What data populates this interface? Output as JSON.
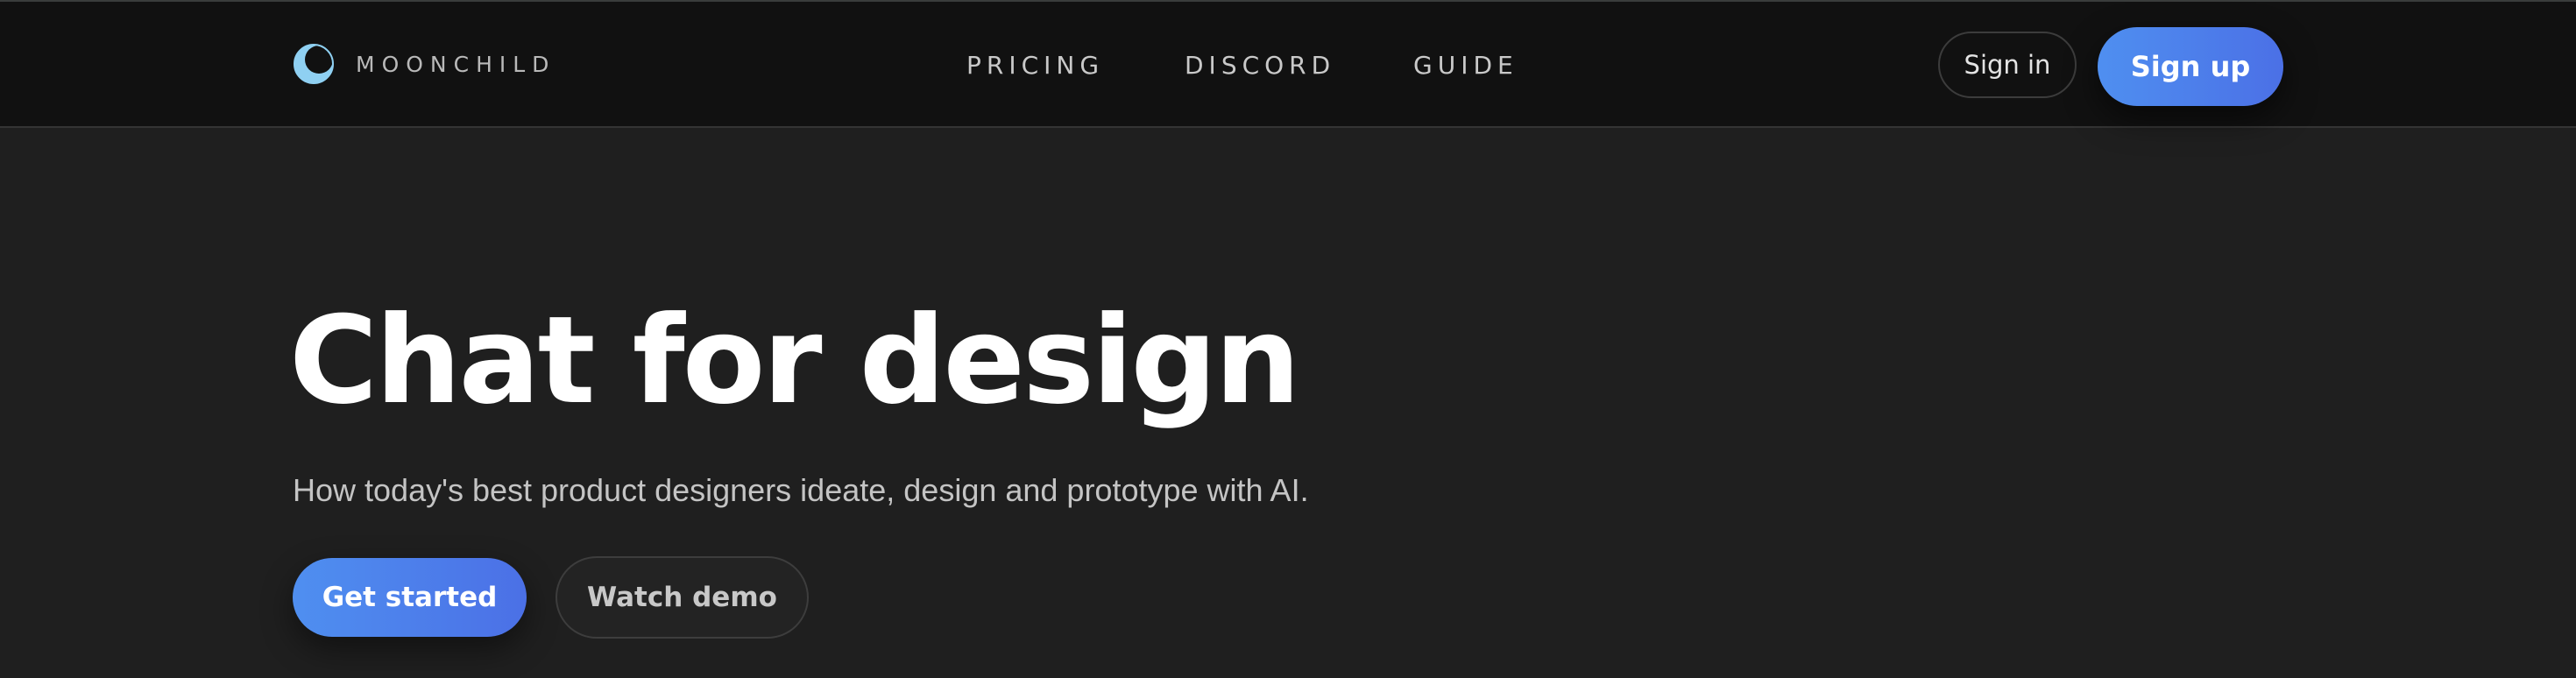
{
  "header": {
    "brand": "MOONCHILD",
    "logo_icon": "crescent-moon-icon",
    "nav": [
      {
        "label": "PRICING"
      },
      {
        "label": "DISCORD"
      },
      {
        "label": "GUIDE"
      }
    ],
    "sign_in_label": "Sign in",
    "sign_up_label": "Sign up"
  },
  "hero": {
    "title": "Chat for design",
    "subtitle": "How today's best product designers ideate, design and prototype with AI.",
    "primary_cta": "Get started",
    "secondary_cta": "Watch demo"
  },
  "colors": {
    "header_bg": "#111111",
    "page_bg": "#1f1f1f",
    "accent_start": "#4f8ff0",
    "accent_end": "#4b70e6",
    "logo_color": "#8fd0f2"
  }
}
